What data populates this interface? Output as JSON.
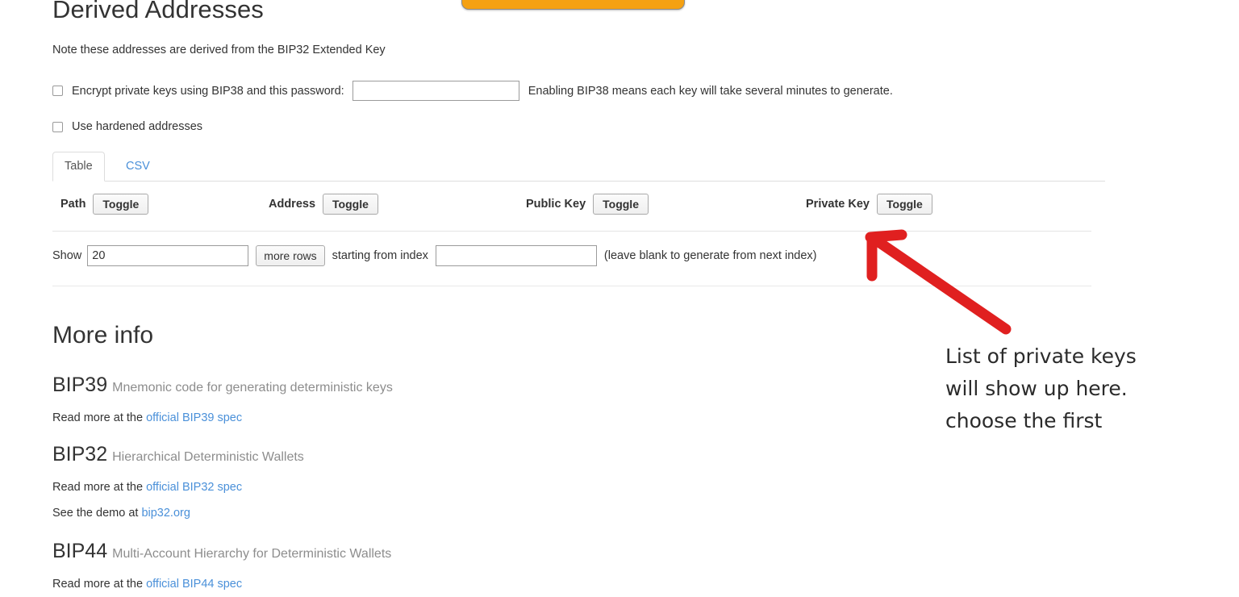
{
  "top_button": {
    "label": "",
    "color": "#f5a112"
  },
  "header": {
    "title": "Derived Addresses",
    "note": "Note these addresses are derived from the BIP32 Extended Key"
  },
  "options": {
    "bip38": {
      "label": "Encrypt private keys using BIP38 and this password:",
      "value": "",
      "placeholder": "",
      "hint": "Enabling BIP38 means each key will take several minutes to generate."
    },
    "hardened": {
      "label": "Use hardened addresses",
      "checked": false
    }
  },
  "tabs": [
    {
      "label": "Table",
      "active": true
    },
    {
      "label": "CSV",
      "active": false
    }
  ],
  "table": {
    "columns": [
      {
        "label": "Path",
        "toggle": "Toggle"
      },
      {
        "label": "Address",
        "toggle": "Toggle"
      },
      {
        "label": "Public Key",
        "toggle": "Toggle"
      },
      {
        "label": "Private Key",
        "toggle": "Toggle"
      }
    ],
    "rows": []
  },
  "rows_control": {
    "show_label": "Show",
    "show_value": "20",
    "more_rows_label": "more rows",
    "starting_label": "starting from index",
    "starting_value": "",
    "hint": "(leave blank to generate from next index)"
  },
  "more_info": {
    "title": "More info",
    "entries": [
      {
        "name": "BIP39",
        "description": "Mnemonic code for generating deterministic keys",
        "lines": [
          {
            "prefix": "Read more at the ",
            "link": "official BIP39 spec"
          }
        ]
      },
      {
        "name": "BIP32",
        "description": "Hierarchical Deterministic Wallets",
        "lines": [
          {
            "prefix": "Read more at the ",
            "link": "official BIP32 spec"
          },
          {
            "prefix": "See the demo at ",
            "link": "bip32.org"
          }
        ]
      },
      {
        "name": "BIP44",
        "description": "Multi-Account Hierarchy for Deterministic Wallets",
        "lines": [
          {
            "prefix": "Read more at the ",
            "link": "official BIP44 spec"
          }
        ]
      }
    ]
  },
  "annotation": {
    "text": "List of private keys will show up here. choose the first",
    "arrow_color": "#e02020",
    "text_color": "#2b2b2b"
  }
}
